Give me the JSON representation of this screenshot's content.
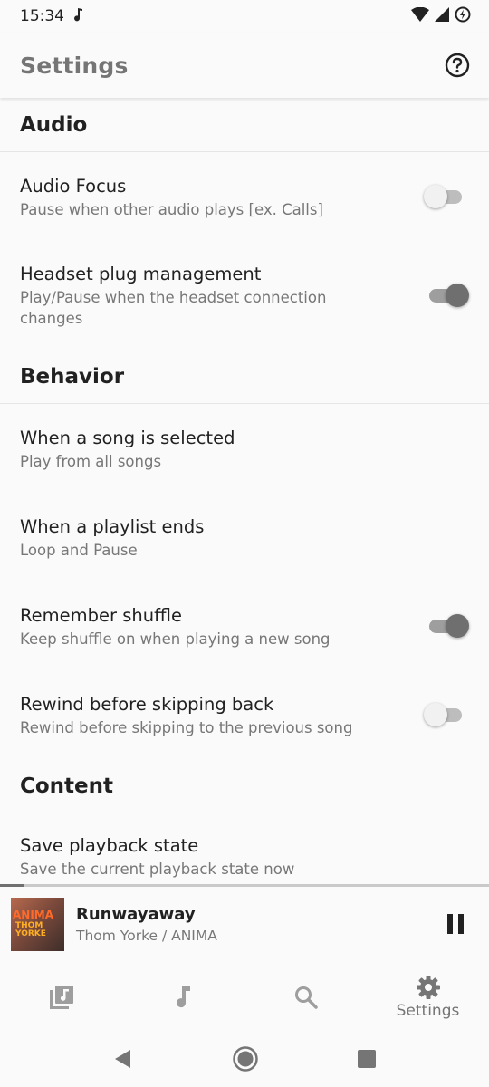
{
  "status_bar": {
    "time": "15:34"
  },
  "app_bar": {
    "title": "Settings"
  },
  "sections": {
    "audio": {
      "header": "Audio",
      "audio_focus": {
        "title": "Audio Focus",
        "summary": "Pause when other audio plays [ex. Calls]",
        "enabled": false
      },
      "headset": {
        "title": "Headset plug management",
        "summary": "Play/Pause when the headset connection changes",
        "enabled": true
      }
    },
    "behavior": {
      "header": "Behavior",
      "song_selected": {
        "title": "When a song is selected",
        "summary": "Play from all songs"
      },
      "playlist_ends": {
        "title": "When a playlist ends",
        "summary": "Loop and Pause"
      },
      "remember_shuffle": {
        "title": "Remember shuffle",
        "summary": "Keep shuffle on when playing a new song",
        "enabled": true
      },
      "rewind": {
        "title": "Rewind before skipping back",
        "summary": "Rewind before skipping to the previous song",
        "enabled": false
      }
    },
    "content": {
      "header": "Content",
      "save_state": {
        "title": "Save playback state",
        "summary": "Save the current playback state now"
      }
    }
  },
  "player": {
    "title": "Runwayaway",
    "artist": "Thom Yorke / ANIMA",
    "album_art_text": "ANIMA",
    "album_art_subtext": "THOM YORKE",
    "progress": 0.05
  },
  "bottom_nav": {
    "items": [
      {
        "icon": "library-music-icon"
      },
      {
        "icon": "music-note-icon"
      },
      {
        "icon": "search-icon"
      },
      {
        "icon": "gear-icon",
        "label": "Settings"
      }
    ]
  },
  "colors": {
    "accent": "#6f6f6f",
    "title": "#757575"
  }
}
